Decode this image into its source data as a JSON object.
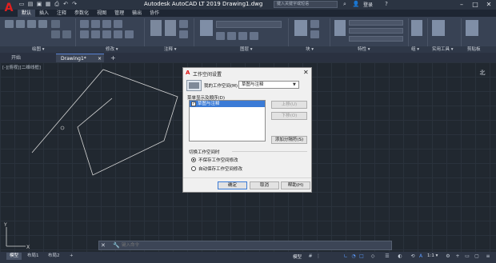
{
  "app": {
    "logo_letter": "A",
    "title": "Autodesk AutoCAD LT 2019    Drawing1.dwg",
    "search_placeholder": "键入关键字或短语",
    "login_label": "登录",
    "window_buttons": [
      "–",
      "□",
      "✕"
    ]
  },
  "ribbon": {
    "tabs": [
      "默认",
      "插入",
      "注释",
      "参数化",
      "视图",
      "管理",
      "输出",
      "协作"
    ],
    "active_tab": "默认",
    "panels": [
      "绘图 ▾",
      "修改 ▾",
      "注释 ▾",
      "图层 ▾",
      "块 ▾",
      "特性 ▾",
      "组 ▾",
      "实用工具 ▾",
      "剪贴板"
    ]
  },
  "file_tabs": {
    "start": "开始",
    "drawing": "Drawing1*",
    "drawing_close": "×",
    "add": "+"
  },
  "canvas": {
    "viewport_label": "[-][俯视][二维线框]",
    "viewcube_label": "北",
    "ucs_y": "Y",
    "ucs_x": "X"
  },
  "command_line": {
    "close_glyph": "✕",
    "wrench_glyph": "🔧",
    "placeholder": "键入命令"
  },
  "layout_tabs": [
    "模型",
    "布局1",
    "布局2",
    "+"
  ],
  "status_bar": {
    "model": "模型",
    "scale": "1:1 ▾"
  },
  "dialog": {
    "title": "工作空间设置",
    "close_glyph": "✕",
    "my_workspace_label": "我的工作空间(M) =",
    "my_workspace_value": "草图与注释",
    "menu_order_label": "菜单显示及顺序(D)",
    "list_items": [
      {
        "label": "草图与注释",
        "checked": true,
        "selected": true
      }
    ],
    "btn_up": "上移(U)",
    "btn_down": "下移(O)",
    "btn_add_separator": "添加分隔符(S)",
    "switch_group_label": "切换工作空间时",
    "radio_no_save": "不保存工作空间修改",
    "radio_auto_save": "自动保存工作空间修改",
    "radio_selected": "no_save",
    "ok": "确定",
    "cancel": "取消",
    "help": "帮助(H)"
  },
  "colors": {
    "accent": "#3b7bd6",
    "brand_red": "#e02020",
    "canvas_bg": "#212830"
  }
}
